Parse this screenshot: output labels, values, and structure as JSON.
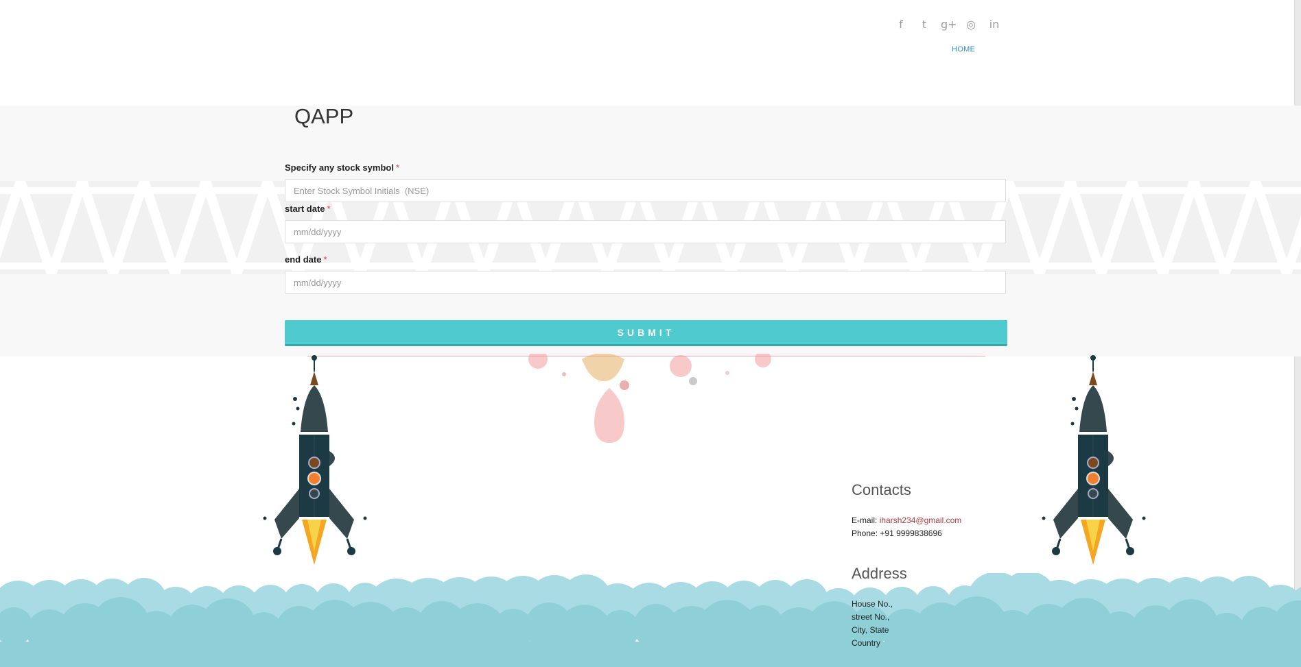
{
  "header": {
    "social_icons": [
      "facebook-icon",
      "twitter-icon",
      "google-plus-icon",
      "dribbble-icon",
      "linkedin-icon"
    ],
    "social_glyphs": [
      "f",
      "t",
      "g+",
      "◎",
      "in"
    ],
    "nav_home": "HOME"
  },
  "form": {
    "title": "QAPP",
    "symbol_label": "Specify any stock symbol",
    "symbol_placeholder": "Enter Stock Symbol Initials  (NSE)",
    "start_label": "start date",
    "start_placeholder": "mm/dd/yyyy",
    "end_label": "end date",
    "end_placeholder": "mm/dd/yyyy",
    "required_mark": "*",
    "submit_label": "SUBMIT"
  },
  "footer": {
    "contacts_heading": "Contacts",
    "email_label": "E-mail:",
    "email": "iharsh234@gmail.com",
    "phone_label": "Phone:",
    "phone": "+91 9999838696",
    "address_heading": "Address",
    "address_lines": [
      "House No.,",
      "street No.,",
      "City, State",
      "Country"
    ]
  },
  "colors": {
    "accent": "#4fcbd0",
    "link_blue": "#2d8fd5",
    "required_red": "#e2394a",
    "email_red": "#b03a3f",
    "cloud": "#8fd0d8"
  }
}
